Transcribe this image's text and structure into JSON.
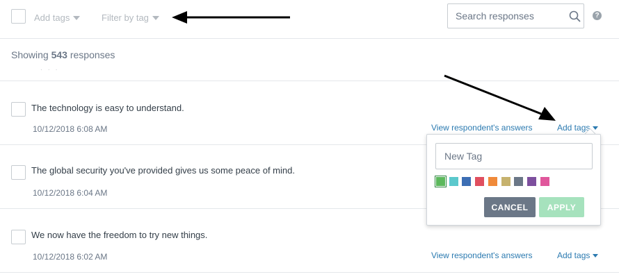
{
  "toolbar": {
    "add_tags_label": "Add tags",
    "filter_by_tag_label": "Filter by tag",
    "search_placeholder": "Search responses",
    "help_glyph": "?"
  },
  "summary": {
    "prefix": "Showing",
    "count": "543",
    "suffix": "responses"
  },
  "responses": [
    {
      "text": "The technology is easy to understand.",
      "date": "10/12/2018 6:08 AM",
      "view_link": "View respondent's answers",
      "add_tags_link": "Add tags"
    },
    {
      "text": "The global security you've provided gives us some peace of mind.",
      "date": "10/12/2018 6:04 AM"
    },
    {
      "text": "We now have the freedom to try new things.",
      "date": "10/12/2018 6:02 AM",
      "view_link": "View respondent's answers",
      "add_tags_link": "Add tags"
    }
  ],
  "tag_popup": {
    "input_placeholder": "New Tag",
    "swatches": [
      "#5cb85c",
      "#5bc8cc",
      "#3c6eb4",
      "#e04f5f",
      "#f08a3a",
      "#c6b26e",
      "#6b7787",
      "#7d4f9e",
      "#e0579c"
    ],
    "cancel_label": "CANCEL",
    "apply_label": "APPLY"
  },
  "colors": {
    "link": "#2b7ab0",
    "cancel_button": "#6b7787",
    "apply_button_disabled": "#a6e2bd"
  }
}
